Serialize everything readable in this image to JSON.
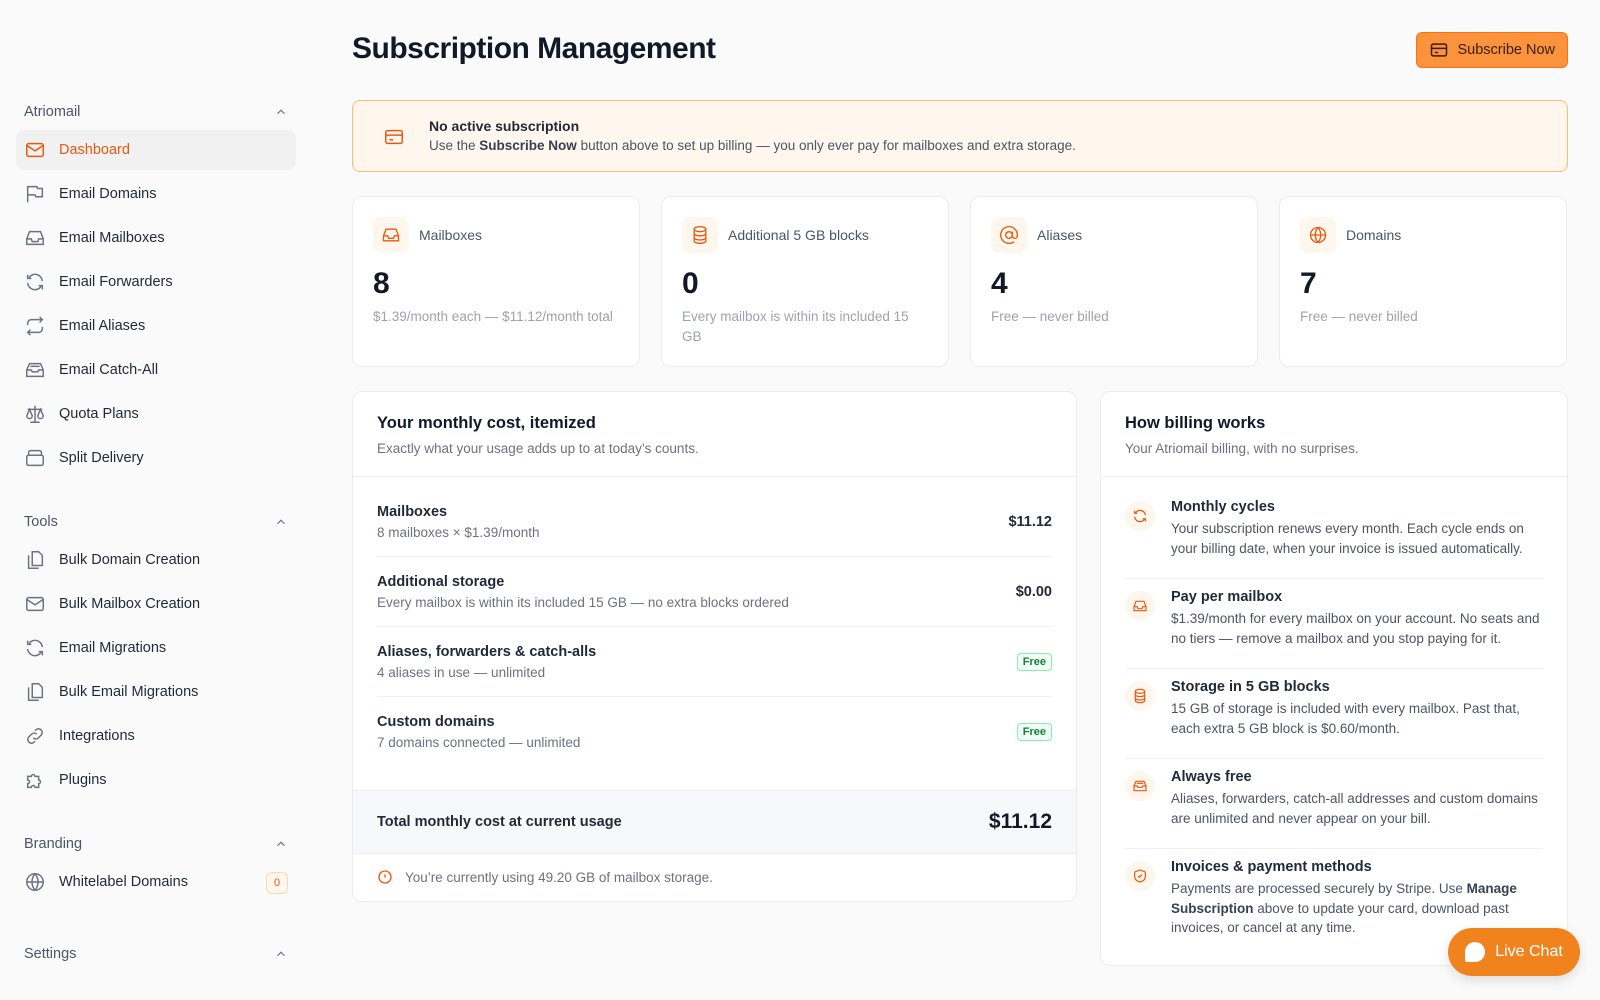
{
  "sidebar": {
    "sections": [
      {
        "title": "Atriomail",
        "items": [
          {
            "label": "Dashboard",
            "icon": "mail-icon"
          },
          {
            "label": "Email Domains",
            "icon": "flag-icon"
          },
          {
            "label": "Email Mailboxes",
            "icon": "inbox-icon"
          },
          {
            "label": "Email Forwarders",
            "icon": "refresh-icon"
          },
          {
            "label": "Email Aliases",
            "icon": "repeat-icon"
          },
          {
            "label": "Email Catch-All",
            "icon": "inbox-stack-icon"
          },
          {
            "label": "Quota Plans",
            "icon": "scale-icon"
          },
          {
            "label": "Split Delivery",
            "icon": "archive-icon"
          }
        ]
      },
      {
        "title": "Tools",
        "items": [
          {
            "label": "Bulk Domain Creation",
            "icon": "copy-icon"
          },
          {
            "label": "Bulk Mailbox Creation",
            "icon": "mail-icon"
          },
          {
            "label": "Email Migrations",
            "icon": "refresh-icon"
          },
          {
            "label": "Bulk Email Migrations",
            "icon": "copy-icon"
          },
          {
            "label": "Integrations",
            "icon": "link-icon"
          },
          {
            "label": "Plugins",
            "icon": "puzzle-icon"
          }
        ]
      },
      {
        "title": "Branding",
        "items": [
          {
            "label": "Whitelabel Domains",
            "icon": "globe-icon",
            "badge": "0"
          }
        ]
      },
      {
        "title": "Settings",
        "items": []
      }
    ]
  },
  "header": {
    "title": "Subscription Management",
    "subscribe_label": "Subscribe Now"
  },
  "alert": {
    "title": "No active subscription",
    "text_before": "Use the ",
    "text_bold": "Subscribe Now",
    "text_after": " button above to set up billing — you only ever pay for mailboxes and extra storage."
  },
  "stats": [
    {
      "label": "Mailboxes",
      "value": "8",
      "desc": "$1.39/month each — $11.12/month total",
      "icon": "inbox-icon"
    },
    {
      "label": "Additional 5 GB blocks",
      "value": "0",
      "desc": "Every mailbox is within its included 15 GB",
      "icon": "database-icon"
    },
    {
      "label": "Aliases",
      "value": "4",
      "desc": "Free — never billed",
      "icon": "at-icon"
    },
    {
      "label": "Domains",
      "value": "7",
      "desc": "Free — never billed",
      "icon": "globe-icon"
    }
  ],
  "cost": {
    "title": "Your monthly cost, itemized",
    "subtitle": "Exactly what your usage adds up to at today’s counts.",
    "rows": [
      {
        "name": "Mailboxes",
        "detail": "8 mailboxes × $1.39/month",
        "amount": "$11.12"
      },
      {
        "name": "Additional storage",
        "detail": "Every mailbox is within its included 15 GB — no extra blocks ordered",
        "amount": "$0.00"
      },
      {
        "name": "Aliases, forwarders & catch-alls",
        "detail": "4 aliases in use — unlimited",
        "badge": "Free"
      },
      {
        "name": "Custom domains",
        "detail": "7 domains connected — unlimited",
        "badge": "Free"
      }
    ],
    "total_label": "Total monthly cost at current usage",
    "total_amount": "$11.12",
    "note": "You’re currently using 49.20 GB of mailbox storage."
  },
  "billing": {
    "title": "How billing works",
    "subtitle": "Your Atriomail billing, with no surprises.",
    "items": [
      {
        "title": "Monthly cycles",
        "text": "Your subscription renews every month. Each cycle ends on your billing date, when your invoice is issued automatically.",
        "icon": "refresh-icon"
      },
      {
        "title": "Pay per mailbox",
        "text": "$1.39/month for every mailbox on your account. No seats and no tiers — remove a mailbox and you stop paying for it.",
        "icon": "inbox-icon"
      },
      {
        "title": "Storage in 5 GB blocks",
        "text": "15 GB of storage is included with every mailbox. Past that, each extra 5 GB block is $0.60/month.",
        "icon": "database-icon"
      },
      {
        "title": "Always free",
        "text": "Aliases, forwarders, catch-all addresses and custom domains are unlimited and never appear on your bill.",
        "icon": "inbox-stack-icon"
      },
      {
        "title": "Invoices & payment methods",
        "text_before": "Payments are processed securely by Stripe. Use ",
        "text_bold": "Manage Subscription",
        "text_after": " above to update your card, download past invoices, or cancel at any time.",
        "icon": "shield-icon"
      }
    ]
  },
  "live_chat": {
    "label": "Live Chat"
  },
  "colors": {
    "accent": "#ea580c",
    "button": "#fb923c",
    "alert_bg": "#fff7ed",
    "free_green": "#15803d"
  }
}
